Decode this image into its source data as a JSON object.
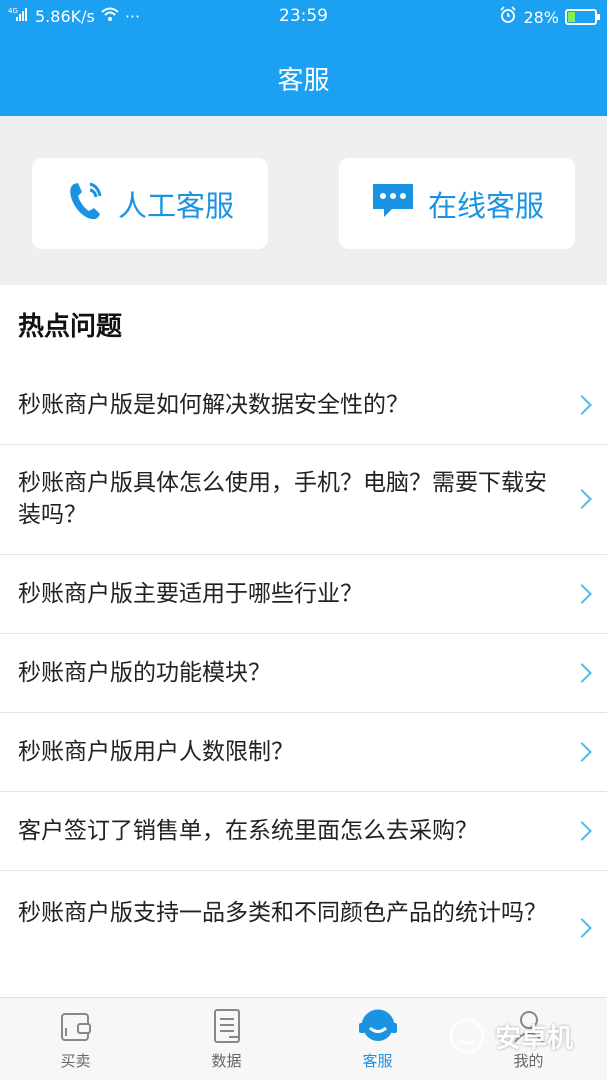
{
  "status_bar": {
    "network": "4G",
    "speed": "5.86K/s",
    "more": "···",
    "time": "23:59",
    "battery": "28%",
    "battery_level": 0.28
  },
  "header": {
    "title": "客服"
  },
  "service_buttons": {
    "manual": {
      "label": "人工客服",
      "icon": "phone-icon"
    },
    "online": {
      "label": "在线客服",
      "icon": "chat-icon"
    }
  },
  "hot": {
    "title": "热点问题",
    "items": [
      {
        "text": "秒账商户版是如何解决数据安全性的？"
      },
      {
        "text": "秒账商户版具体怎么使用，手机？电脑？需要下载安装吗？"
      },
      {
        "text": "秒账商户版主要适用于哪些行业？"
      },
      {
        "text": "秒账商户版的功能模块？"
      },
      {
        "text": "秒账商户版用户人数限制？"
      },
      {
        "text": "客户签订了销售单，在系统里面怎么去采购？"
      },
      {
        "text": "秒账商户版支持一品多类和不同颜色产品的统计吗？"
      }
    ]
  },
  "tabbar": {
    "tabs": [
      {
        "label": "买卖",
        "icon": "wallet-icon"
      },
      {
        "label": "数据",
        "icon": "document-icon"
      },
      {
        "label": "客服",
        "icon": "headset-icon",
        "active": true
      },
      {
        "label": "我的",
        "icon": "user-icon"
      }
    ]
  },
  "watermark": {
    "text": "安卓机"
  },
  "colors": {
    "brand": "#1ba0f2",
    "accent": "#1b93e3"
  }
}
